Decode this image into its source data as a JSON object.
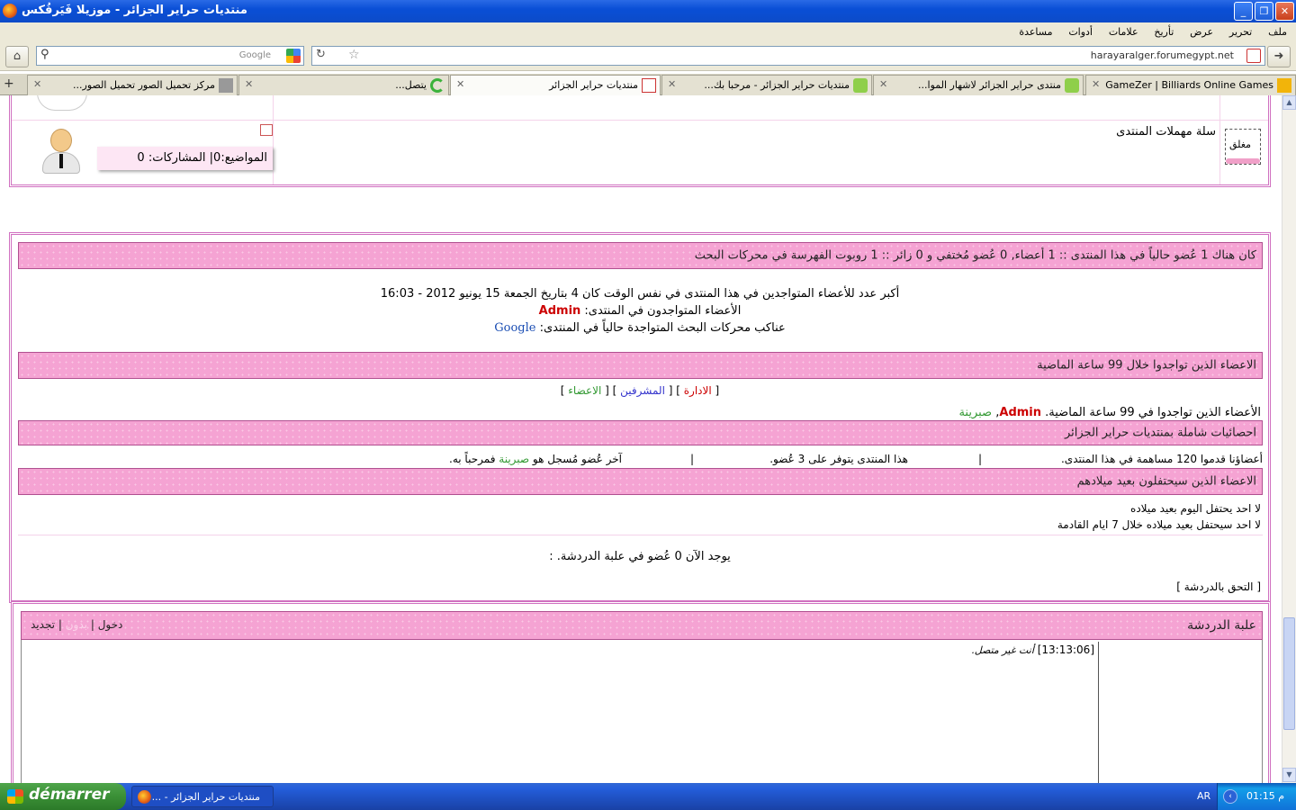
{
  "window": {
    "title": "منتديات حراير الجزائر - موزيلا فَيَرفُكس",
    "controls": {
      "minimize": "_",
      "restore": "❐",
      "close": "✕"
    }
  },
  "menu": [
    "ملف",
    "تحرير",
    "عرض",
    "تأريخ",
    "علامات",
    "أدوات",
    "مساعدة"
  ],
  "nav": {
    "url": "harayaralger.forumegypt.net",
    "search_placeholder": "Google"
  },
  "tabs": [
    {
      "label": "GameZer | Billiards Online Games",
      "active": false
    },
    {
      "label": "منتدى حراير الجزائر لاشهار الموا...",
      "active": false
    },
    {
      "label": "منتديات حراير الجزائر - مرحبا بك...",
      "active": false
    },
    {
      "label": "منتديات حراير الجزائر",
      "active": true
    },
    {
      "label": "يتصل...",
      "active": false
    },
    {
      "label": "مركز تحميل الصور تحميل الصور...",
      "active": false
    }
  ],
  "forum_row": {
    "locked_label": "مغلق",
    "forum_name": "سلة مهملات المنتدى",
    "stats": "المواضيع:0| المشاركات: 0"
  },
  "who_online": {
    "header": "كان هناك 1 عُضو حالياً في هذا المنتدى :: 1 أعضاء, 0 عُضو مُختفي و 0 زائر :: 1 روبوت الفهرسة في محركات البحث",
    "record": "أكبر عدد للأعضاء المتواجدين في هذا المنتدى في نفس الوقت كان 4 بتاريخ الجمعة 15 يونيو 2012 - 16:03",
    "online_label": "الأعضاء المتواجدون في المنتدى:",
    "online_user": "Admin",
    "bots_label": "عناكب محركات البحث المتواجدة حالياً في المنتدى:",
    "bots_value": "Google"
  },
  "last_99": {
    "header": "الاعضاء الذين تواجدوا خلال 99 ساعة الماضية",
    "legend_open": "[",
    "legend_admin": "الادارة",
    "legend_mods": "المشرفين",
    "legend_members": "الاعضاء",
    "legend_sep": "] [",
    "legend_close": "]",
    "line_label": "الأعضاء الذين تواجدوا في 99 ساعة الماضية.",
    "user1": "Admin",
    "user2": "صبرينة"
  },
  "stats": {
    "header": "احصائيات شاملة بمنتديات حراير الجزائر",
    "posts": "أعضاؤنا قدموا 120 مساهمة في هذا المنتدى.",
    "members": "هذا المنتدى يتوفر على 3 عُضو.",
    "newest_label": "آخر عُضو مُسجل هو",
    "newest_user": "صبرينة",
    "newest_suffix": "فمرحباً به."
  },
  "birthdays": {
    "header": "الاعضاء الذين سيحتفلون بعيد ميلادهم",
    "today": "لا احد يحتفل اليوم بعيد ميلاده",
    "week": "لا احد سيحتفل بعيد ميلاده خلال 7 ايام القادمة"
  },
  "chat_info": {
    "now": "يوجد الآن 0 عُضو في علبة الدردشة. :",
    "join": "[ التحق بالدردشة ]"
  },
  "chatbox": {
    "title": "علبة الدردشة",
    "refresh": "تجديد",
    "hidden": "بدون",
    "login": "دخول",
    "sep": "|",
    "time": "[13:13:06]",
    "message": "أنت غير متصل."
  },
  "taskbar": {
    "start": "démarrer",
    "task": "منتديات حراير الجزائر - ...",
    "lang": "AR",
    "clock": "م 01:15"
  },
  "colors": {
    "pink_bar": "#f5a3d3",
    "frame": "#d070c0",
    "admin": "#cc0000",
    "member": "#339933",
    "mod": "#3333cc"
  }
}
